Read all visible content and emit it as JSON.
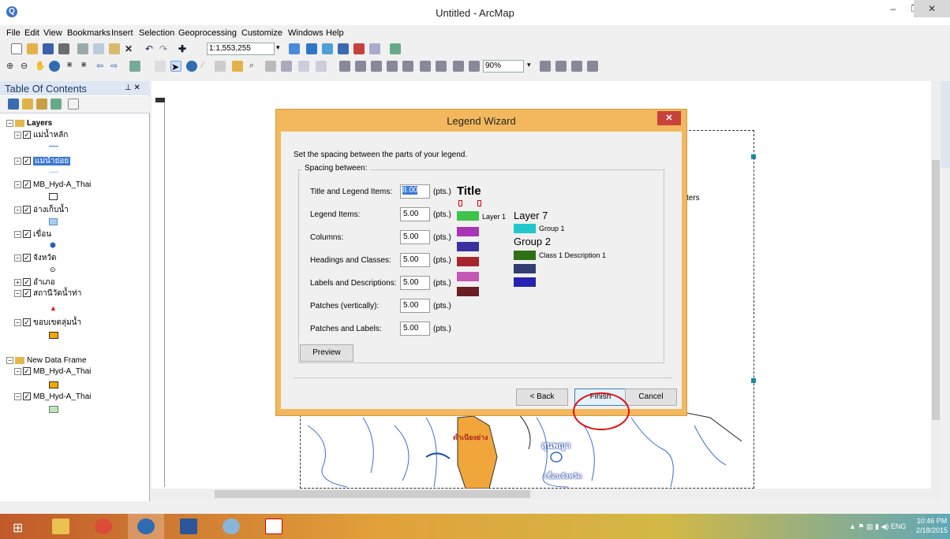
{
  "window": {
    "title": "Untitled - ArcMap"
  },
  "menu": [
    "File",
    "Edit",
    "View",
    "Bookmarks",
    "Insert",
    "Selection",
    "Geoprocessing",
    "Customize",
    "Windows",
    "Help"
  ],
  "toolbar": {
    "scale": "1:1,553,255",
    "zoom": "90%"
  },
  "toc": {
    "title": "Table Of Contents",
    "items": [
      {
        "label": "Layers",
        "kind": "group"
      },
      {
        "label": "แม่น้ำหลัก"
      },
      {
        "label": "แม่น้ำย่อย",
        "selected": true
      },
      {
        "label": "MB_Hyd-A_Thai"
      },
      {
        "label": "อ่างเก็บน้ำ"
      },
      {
        "label": "เขื่อน"
      },
      {
        "label": "จังหวัด"
      },
      {
        "label": "อำเภอ"
      },
      {
        "label": "สถานีวัดน้ำท่า"
      },
      {
        "label": "ขอบเขตลุ่มน้ำ"
      },
      {
        "label": "New Data Frame",
        "kind": "group"
      },
      {
        "label": "MB_Hyd-A_Thai"
      },
      {
        "label": "MB_Hyd-A_Thai"
      }
    ]
  },
  "map": {
    "partial_text": "ters",
    "labels": [
      "ดำเนียงย่าง",
      "สุนพญา",
      "เขื่อนจังหวัด"
    ]
  },
  "dialog": {
    "title": "Legend Wizard",
    "instruction": "Set the spacing between the parts of your legend.",
    "group_label": "Spacing between:",
    "rows": [
      {
        "label": "Title and Legend Items:",
        "value": "8.00",
        "unit": "(pts.)"
      },
      {
        "label": "Legend Items:",
        "value": "5.00",
        "unit": "(pts.)"
      },
      {
        "label": "Columns:",
        "value": "5.00",
        "unit": "(pts.)"
      },
      {
        "label": "Headings and Classes:",
        "value": "5.00",
        "unit": "(pts.)"
      },
      {
        "label": "Labels and Descriptions:",
        "value": "5.00",
        "unit": "(pts.)"
      },
      {
        "label": "Patches (vertically):",
        "value": "5.00",
        "unit": "(pts.)"
      },
      {
        "label": "Patches and Labels:",
        "value": "5.00",
        "unit": "(pts.)"
      }
    ],
    "preview": {
      "title": "Title",
      "layer1": "Layer 1",
      "layer7": "Layer 7",
      "group1": "Group 1",
      "group2": "Group 2",
      "class1": "Class 1 Description 1",
      "colors": {
        "left": [
          "#3cc34a",
          "#a835b4",
          "#3b2fa1",
          "#a6262c",
          "#c558b4",
          "#6a1e22"
        ],
        "group1": "#20c8cc",
        "right": [
          "#2e6f17",
          "#323d72",
          "#2722b3"
        ]
      }
    },
    "buttons": {
      "preview": "Preview",
      "back": "< Back",
      "finish": "Finish",
      "cancel": "Cancel"
    }
  },
  "taskbar": {
    "time": "10:46 PM",
    "date": "2/18/2015",
    "lang": "ENG"
  }
}
